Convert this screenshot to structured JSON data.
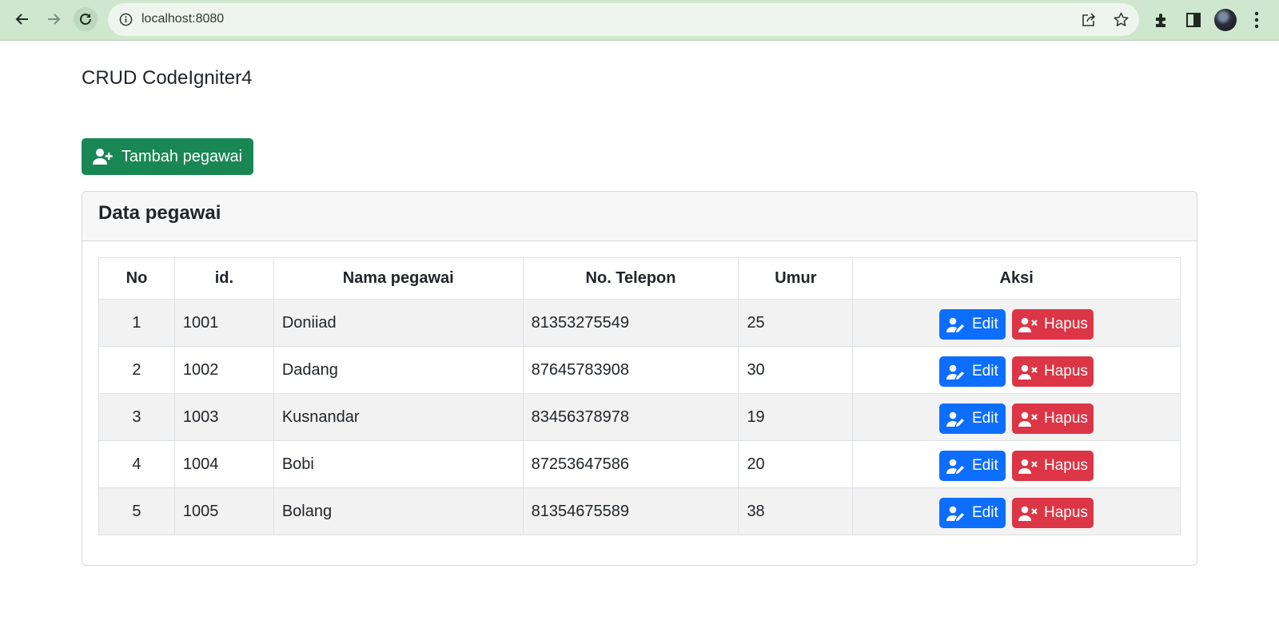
{
  "browser": {
    "url": "localhost:8080"
  },
  "page": {
    "title": "CRUD CodeIgniter4",
    "add_button_label": "Tambah pegawai",
    "add_button_icon": "user-plus-icon"
  },
  "card": {
    "title": "Data pegawai",
    "columns": [
      "No",
      "id.",
      "Nama pegawai",
      "No. Telepon",
      "Umur",
      "Aksi"
    ],
    "rows": [
      {
        "no": "1",
        "id": "1001",
        "nama": "Doniiad",
        "telepon": "81353275549",
        "umur": "25"
      },
      {
        "no": "2",
        "id": "1002",
        "nama": "Dadang",
        "telepon": "87645783908",
        "umur": "30"
      },
      {
        "no": "3",
        "id": "1003",
        "nama": "Kusnandar",
        "telepon": "83456378978",
        "umur": "19"
      },
      {
        "no": "4",
        "id": "1004",
        "nama": "Bobi",
        "telepon": "87253647586",
        "umur": "20"
      },
      {
        "no": "5",
        "id": "1005",
        "nama": "Bolang",
        "telepon": "81354675589",
        "umur": "38"
      }
    ],
    "edit_label": "Edit",
    "delete_label": "Hapus"
  },
  "colors": {
    "chrome": "#cfe6cf",
    "success": "#198754",
    "primary": "#0d6efd",
    "danger": "#dc3545"
  }
}
